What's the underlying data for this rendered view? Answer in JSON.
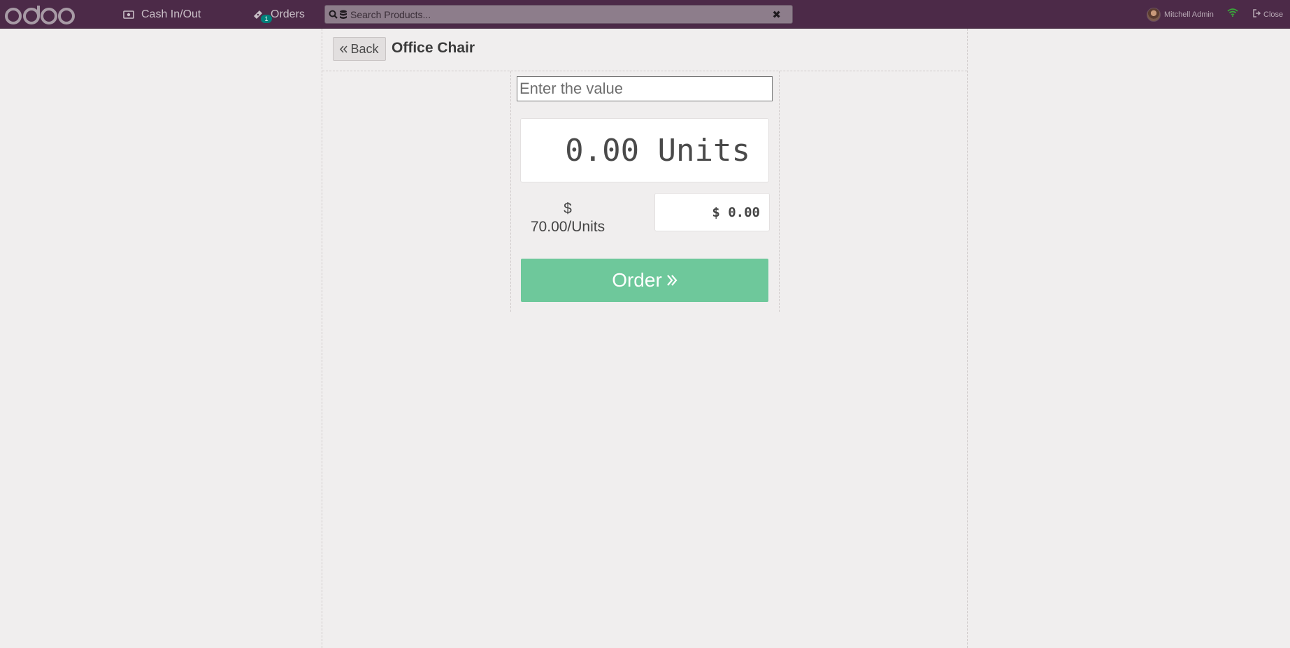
{
  "topbar": {
    "logo": "odoo",
    "cash_label": "Cash In/Out",
    "orders_label": "Orders",
    "orders_count": "1",
    "search_placeholder": "Search Products...",
    "clear_symbol": "✖",
    "user_name": "Mitchell Admin",
    "close_label": "Close",
    "colors": {
      "bar": "#4c2a48",
      "wifi": "#3aa63a",
      "badge": "#00807a"
    }
  },
  "header": {
    "back_label": "Back",
    "product_title": "Office Chair"
  },
  "panel": {
    "value_placeholder": "Enter the value",
    "quantity_display": "0.00 Units",
    "unit_price_symbol": "$",
    "unit_price_value": "70.00/Units",
    "total_display": "$ 0.00",
    "order_label": "Order",
    "order_color": "#6ec89b"
  }
}
